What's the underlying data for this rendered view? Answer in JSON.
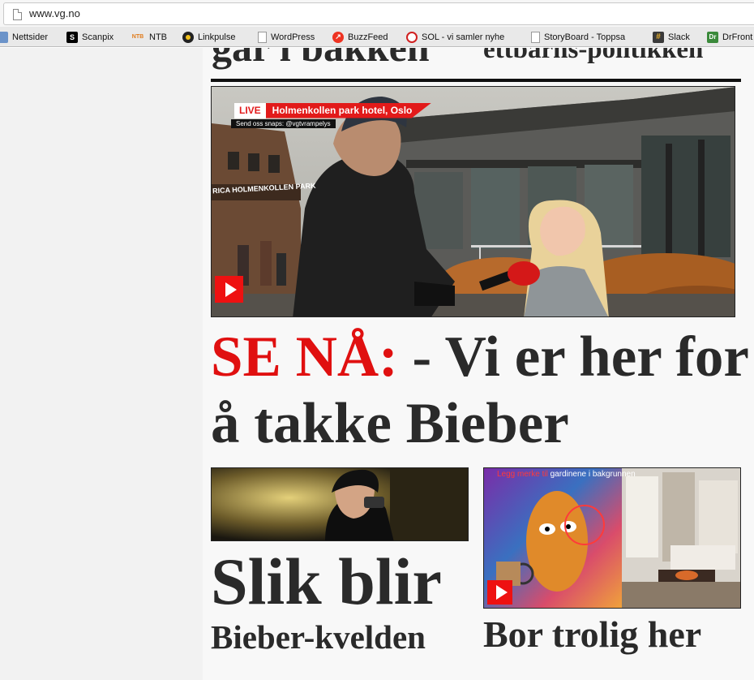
{
  "browser": {
    "url": "www.vg.no",
    "bookmarks": [
      {
        "label": "Nettsider",
        "icon": "folder-icon"
      },
      {
        "label": "Scanpix",
        "icon": "scanpix-icon"
      },
      {
        "label": "NTB",
        "icon": "ntb-icon"
      },
      {
        "label": "Linkpulse",
        "icon": "linkpulse-icon"
      },
      {
        "label": "WordPress",
        "icon": "page-icon"
      },
      {
        "label": "BuzzFeed",
        "icon": "buzzfeed-icon"
      },
      {
        "label": "SOL - vi samler nyhe",
        "icon": "sol-icon"
      },
      {
        "label": "StoryBoard - Toppsa",
        "icon": "page-icon"
      },
      {
        "label": "Slack",
        "icon": "slack-icon"
      },
      {
        "label": "DrFront",
        "icon": "dr-icon"
      }
    ]
  },
  "page": {
    "cut_headline_left": "går i bakken",
    "cut_headline_right": "ettbarns-politikken",
    "video": {
      "live_label": "LIVE",
      "live_location": "Holmenkollen park hotel, Oslo",
      "snaps_text": "Send oss snaps: @vgtvrampelys",
      "sign_text": "RICA HOLMENKOLLEN PARK"
    },
    "main_headline": {
      "kicker": "SE NÅ:",
      "text": " - Vi er her for å takke Bieber"
    },
    "story_left": {
      "title_large": "Slik blir",
      "title_small": "Bieber-kvelden"
    },
    "story_right": {
      "overlay_highlight": "Legg merke til",
      "overlay_text": " gardinene i bakgrunnen",
      "title": "Bor trolig her"
    },
    "colors": {
      "accent_red": "#e01010",
      "headline_text": "#2a2a2a",
      "play_red": "#ee1111"
    }
  }
}
